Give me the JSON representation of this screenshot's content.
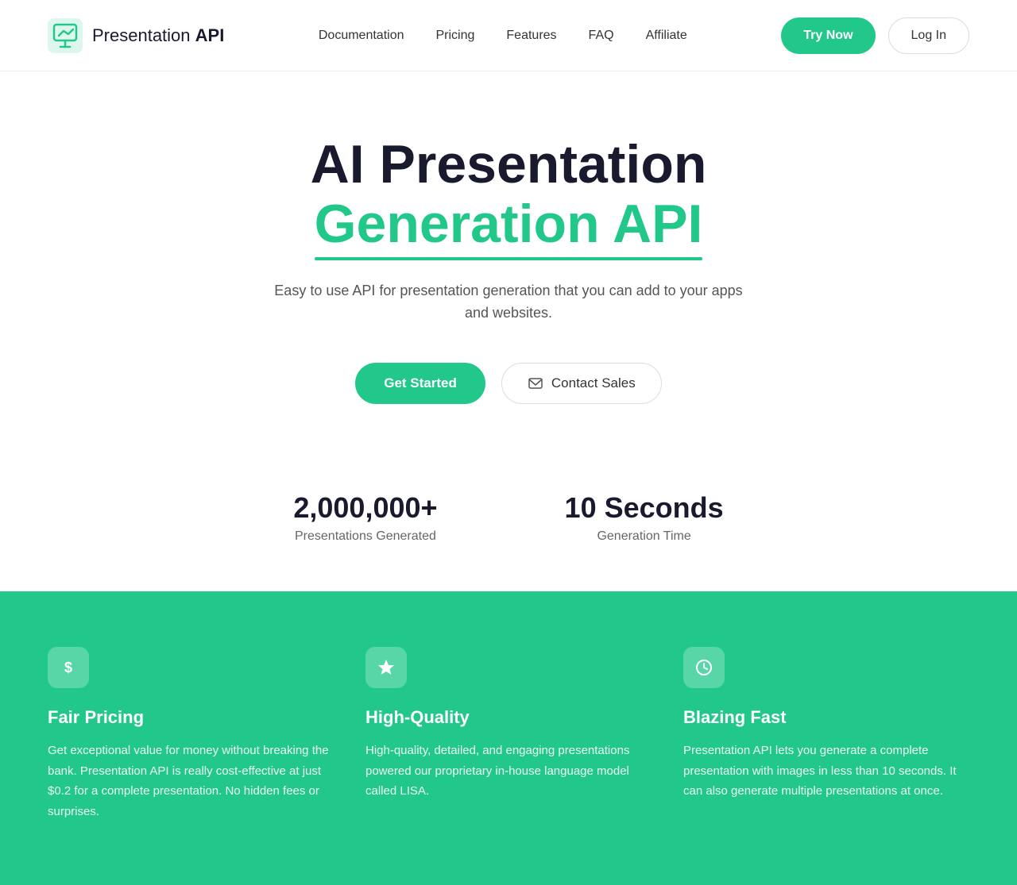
{
  "header": {
    "logo_text_presentation": "Presentation",
    "logo_text_api": "API",
    "nav": {
      "documentation": "Documentation",
      "pricing": "Pricing",
      "features": "Features",
      "faq": "FAQ",
      "affiliate": "Affiliate"
    },
    "try_now": "Try Now",
    "login": "Log In"
  },
  "hero": {
    "title_line1": "AI Presentation",
    "title_line2": "Generation API",
    "subtitle": "Easy to use API for presentation generation that you can add to your apps and websites.",
    "get_started": "Get Started",
    "contact_sales": "Contact Sales"
  },
  "stats": [
    {
      "number": "2,000,000+",
      "label": "Presentations Generated"
    },
    {
      "number": "10 Seconds",
      "label": "Generation Time"
    }
  ],
  "features": [
    {
      "icon": "dollar-icon",
      "icon_char": "$",
      "title": "Fair Pricing",
      "description": "Get exceptional value for money without breaking the bank. Presentation API is really cost-effective at just $0.2 for a complete presentation. No hidden fees or surprises."
    },
    {
      "icon": "star-icon",
      "icon_char": "★",
      "title": "High-Quality",
      "description": "High-quality, detailed, and engaging presentations powered our proprietary in-house language model called LISA."
    },
    {
      "icon": "clock-icon",
      "icon_char": "🕐",
      "title": "Blazing Fast",
      "description": "Presentation API lets you generate a complete presentation with images in less than 10 seconds. It can also generate multiple presentations at once."
    }
  ]
}
